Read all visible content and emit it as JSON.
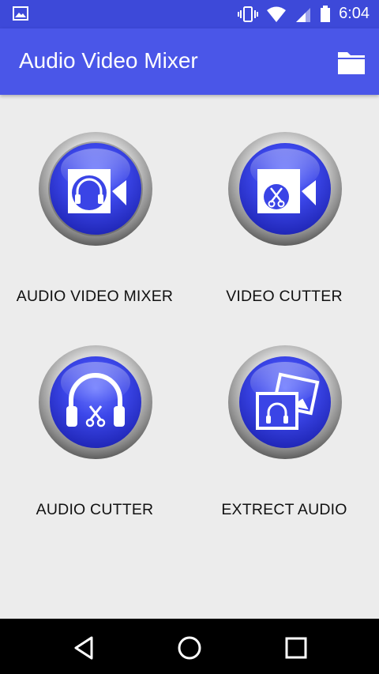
{
  "status_bar": {
    "time": "6:04",
    "icons": [
      "image-notification-icon",
      "vibrate-icon",
      "wifi-icon",
      "cell-signal-icon",
      "battery-icon"
    ]
  },
  "app_bar": {
    "title": "Audio Video Mixer",
    "folder_icon": "folder-icon"
  },
  "tiles": [
    {
      "label": "AUDIO VIDEO MIXER",
      "icon": "headphone-video-icon"
    },
    {
      "label": "VIDEO CUTTER",
      "icon": "video-scissors-icon"
    },
    {
      "label": "AUDIO CUTTER",
      "icon": "headphone-scissors-icon"
    },
    {
      "label": "EXTRECT AUDIO",
      "icon": "photo-headphone-icon"
    }
  ],
  "nav_bar": {
    "icons": [
      "back-icon",
      "home-icon",
      "recents-icon"
    ]
  },
  "colors": {
    "status_bar": "#3d49d9",
    "app_bar": "#4a56e8",
    "background": "#ececec",
    "button_blue": "#3a44e6"
  }
}
